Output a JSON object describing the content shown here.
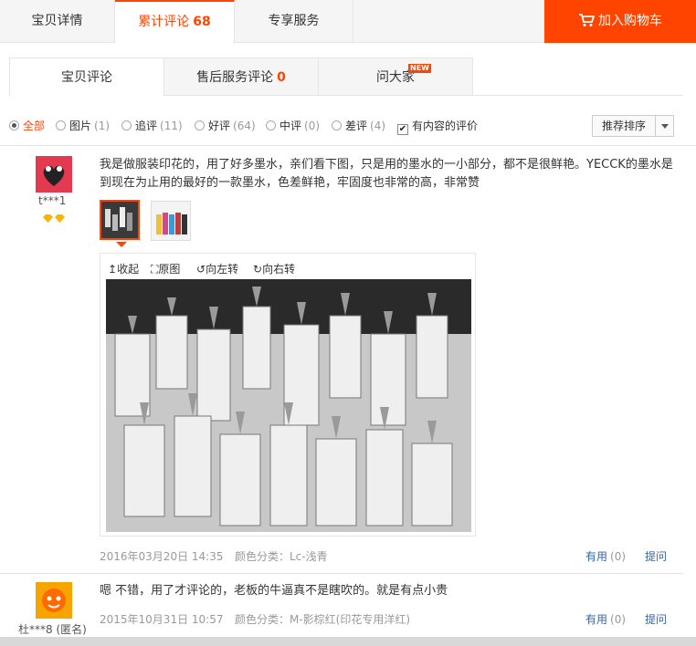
{
  "top_tabs": [
    {
      "label": "宝贝详情"
    },
    {
      "label": "累计评论",
      "count": "68"
    },
    {
      "label": "专享服务"
    }
  ],
  "cart_button": "加入购物车",
  "sub_tabs": [
    {
      "label": "宝贝评论"
    },
    {
      "label": "售后服务评论",
      "count": "0"
    },
    {
      "label": "问大家",
      "badge": "NEW"
    }
  ],
  "filters": [
    {
      "label": "全部",
      "count": ""
    },
    {
      "label": "图片",
      "count": "(1)"
    },
    {
      "label": "追评",
      "count": "(11)"
    },
    {
      "label": "好评",
      "count": "(64)"
    },
    {
      "label": "中评",
      "count": "(0)"
    },
    {
      "label": "差评",
      "count": "(4)"
    }
  ],
  "content_only": {
    "label": "有内容的评价",
    "checked": true
  },
  "sort": {
    "label": "推荐排序"
  },
  "reviews": [
    {
      "user": "t***1",
      "text": "我是做服装印花的，用了好多墨水，亲们看下图，只是用的墨水的一小部分，都不是很鲜艳。YECCK的墨水是到现在为止用的最好的一款墨水，色差鲜艳，牢固度也非常的高，非常赞",
      "viewer_tools": [
        "收起",
        "原图",
        "向左转",
        "向右转"
      ],
      "date": "2016年03月20日 14:35",
      "sku": "颜色分类：Lc-浅青",
      "useful_label": "有用",
      "useful_count": "(0)",
      "ask_label": "提问"
    },
    {
      "user": "杜***8 (匿名)",
      "text": "嗯 不错，用了才评论的，老板的牛逼真不是瞎吹的。就是有点小贵",
      "date": "2015年10月31日 10:57",
      "sku": "颜色分类：M-影棕红(印花专用洋红)",
      "useful_label": "有用",
      "useful_count": "(0)",
      "ask_label": "提问"
    }
  ],
  "colors": {
    "accent": "#ff4400",
    "link": "#3366aa"
  }
}
